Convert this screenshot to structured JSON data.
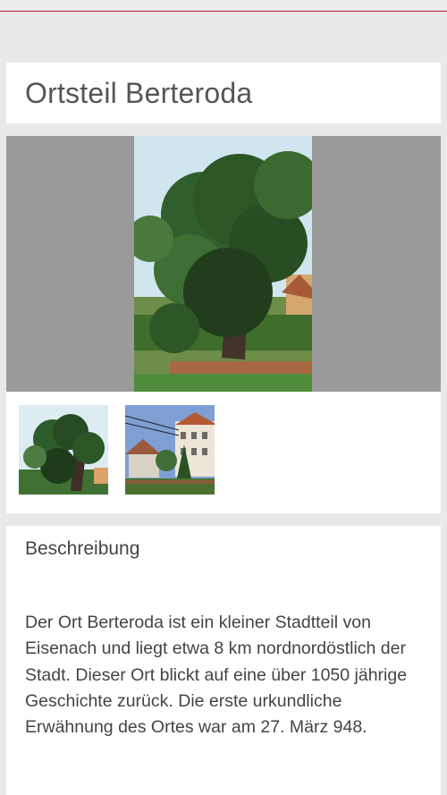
{
  "page": {
    "title": "Ortsteil Berteroda"
  },
  "gallery": {
    "main_image": "oak-tree-photo",
    "thumbnails": [
      "oak-tree-thumbnail",
      "village-house-thumbnail"
    ]
  },
  "description": {
    "heading": "Beschreibung",
    "text": "Der Ort Berteroda ist ein kleiner Stadtteil von Eisenach und liegt etwa 8 km nordnordöstlich der Stadt. Dieser Ort blickt auf eine über 1050 jährige Geschichte zurück. Die erste urkundliche Erwähnung des Ortes war am 27. März 948."
  },
  "colors": {
    "accent": "#b3262c",
    "background": "#e9e9e9"
  }
}
